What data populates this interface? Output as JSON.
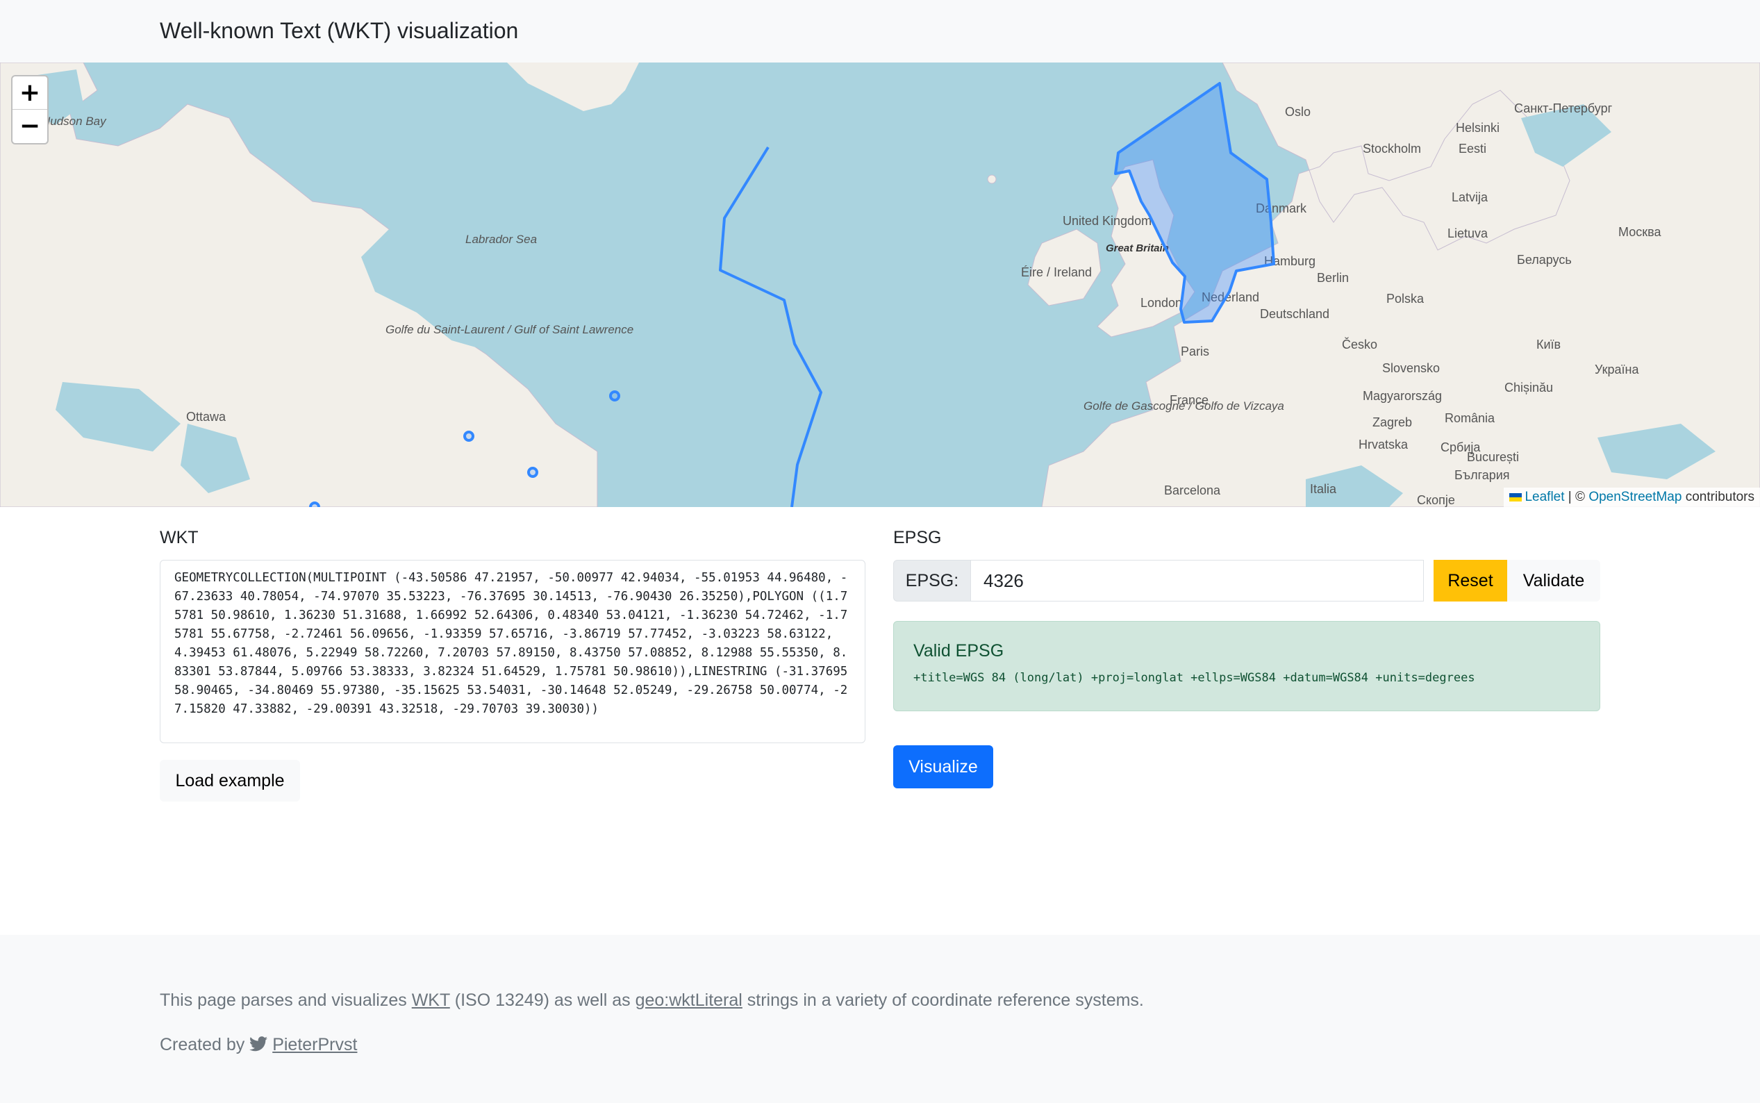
{
  "header": {
    "title": "Well-known Text (WKT) visualization"
  },
  "map": {
    "zoom_in": "+",
    "zoom_out": "−",
    "attribution": {
      "leaflet": "Leaflet",
      "separator": " | © ",
      "osm": "OpenStreetMap",
      "contributors": " contributors"
    },
    "labels": {
      "hudson_bay": "Hudson Bay",
      "labrador_sea": "Labrador Sea",
      "golfe": "Golfe du Saint-Laurent / Gulf of Saint Lawrence",
      "ottawa": "Ottawa",
      "oslo": "Oslo",
      "spb": "Санкт-Петербург",
      "helsinki": "Helsinki",
      "stockholm": "Stockholm",
      "eesti": "Eesti",
      "latvija": "Latvija",
      "lietuva": "Lietuva",
      "moskva": "Москва",
      "belarus": "Беларусь",
      "danmark": "Danmark",
      "uk": "United Kingdom",
      "great_britain": "Great Britain",
      "ireland": "Éire / Ireland",
      "hamburg": "Hamburg",
      "berlin": "Berlin",
      "polska": "Polska",
      "london": "London",
      "nederland": "Nederland",
      "deutschland": "Deutschland",
      "cesko": "Česko",
      "kyiv": "Київ",
      "ukraina": "Україна",
      "paris": "Paris",
      "slovensko": "Slovensko",
      "france": "France",
      "magyarorszag": "Magyarország",
      "chisinau": "Chișinău",
      "zagreb": "Zagreb",
      "romania": "România",
      "golfe_gascogne": "Golfe de Gascogne / Golfo de Vizcaya",
      "hrvatska": "Hrvatska",
      "srbija": "Србија",
      "bucuresti": "București",
      "barcelona": "Barcelona",
      "italia": "Italia",
      "bulgaria": "България",
      "skopje": "Скопје"
    }
  },
  "wkt": {
    "label": "WKT",
    "value": "GEOMETRYCOLLECTION(MULTIPOINT (-43.50586 47.21957, -50.00977 42.94034, -55.01953 44.96480, -67.23633 40.78054, -74.97070 35.53223, -76.37695 30.14513, -76.90430 26.35250),POLYGON ((1.75781 50.98610, 1.36230 51.31688, 1.66992 52.64306, 0.48340 53.04121, -1.36230 54.72462, -1.75781 55.67758, -2.72461 56.09656, -1.93359 57.65716, -3.86719 57.77452, -3.03223 58.63122, 4.39453 61.48076, 5.22949 58.72260, 7.20703 57.89150, 8.43750 57.08852, 8.12988 55.55350, 8.83301 53.87844, 5.09766 53.38333, 3.82324 51.64529, 1.75781 50.98610)),LINESTRING (-31.37695 58.90465, -34.80469 55.97380, -35.15625 53.54031, -30.14648 52.05249, -29.26758 50.00774, -27.15820 47.33882, -29.00391 43.32518, -29.70703 39.30030))",
    "load_example": "Load example"
  },
  "epsg": {
    "label": "EPSG",
    "prefix": "EPSG:",
    "value": "4326",
    "reset": "Reset",
    "validate": "Validate",
    "status_title": "Valid EPSG",
    "proj_string": "+title=WGS 84 (long/lat) +proj=longlat +ellps=WGS84 +datum=WGS84 +units=degrees",
    "visualize": "Visualize"
  },
  "footer": {
    "line1_prefix": "This page parses and visualizes ",
    "wkt_link": "WKT",
    "line1_mid": " (ISO 13249) as well as ",
    "geo_link": "geo:wktLiteral",
    "line1_suffix": " strings in a variety of coordinate reference systems.",
    "created_by": "Created by ",
    "author": "PieterPrvst"
  },
  "colors": {
    "water": "#aad3df",
    "land": "#f2efe9",
    "geometry": "#3388ff",
    "primary": "#0d6efd",
    "warning": "#ffc107",
    "success_bg": "#d1e7dd"
  }
}
